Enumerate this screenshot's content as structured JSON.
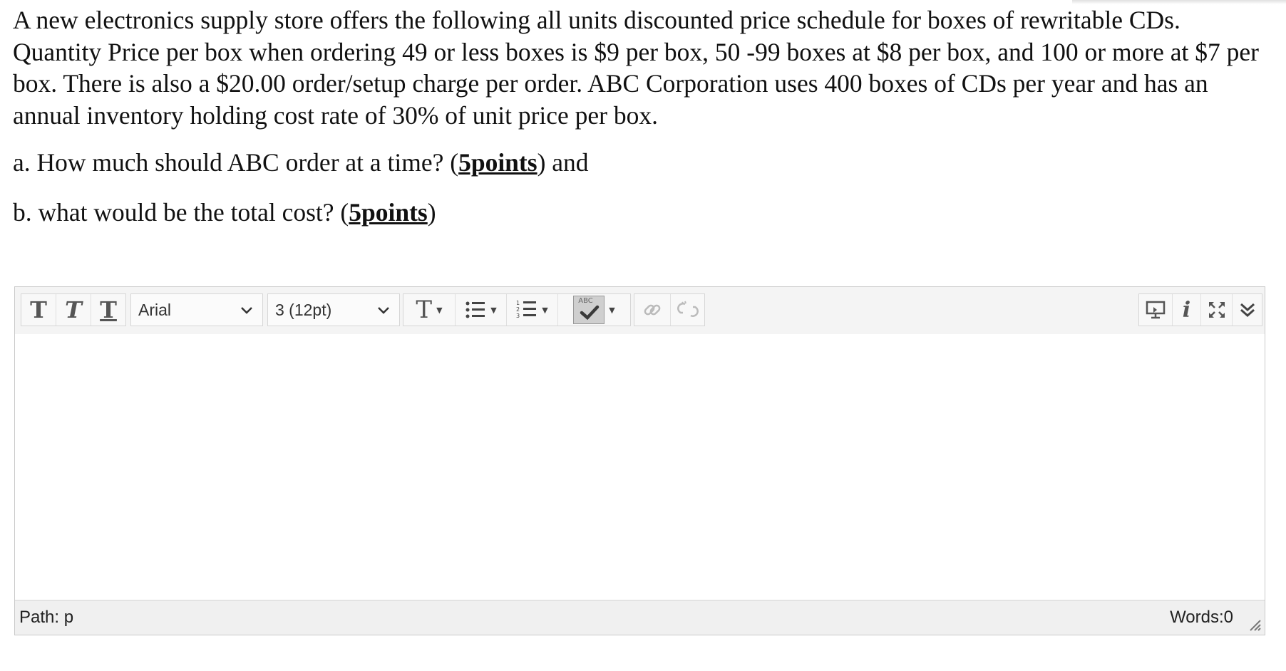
{
  "question": {
    "paragraph": "A new electronics supply store offers the following all units discounted price schedule for boxes of rewritable CDs. Quantity Price per box when ordering 49 or less boxes is $9 per box, 50 -99 boxes at $8 per box, and 100 or more at $7 per box. There is also a $20.00 order/setup charge per order. ABC Corporation uses 400 boxes of CDs per year and has an annual inventory holding cost rate of 30% of unit price per box.",
    "part_a": {
      "text": "a. How much should ABC order at a time? (",
      "points": "5points",
      "suffix": ") and"
    },
    "part_b": {
      "text": "b. what would be the total cost? (",
      "points": "5points",
      "suffix": ")"
    }
  },
  "editor": {
    "toolbar": {
      "bold_label": "T",
      "italic_label": "T",
      "underline_label": "T",
      "font_family": "Arial",
      "font_size": "3 (12pt)",
      "text_color_label": "T",
      "spellcheck_label": "ABC"
    },
    "status": {
      "path": "Path: p",
      "words": "Words:0"
    }
  },
  "icons": {
    "bold": "bold-icon",
    "italic": "italic-icon",
    "underline": "underline-icon",
    "text-color": "text-color-icon",
    "bullet-list": "bullet-list-icon",
    "numbered-list": "numbered-list-icon",
    "spellcheck": "spellcheck-icon",
    "link": "link-icon",
    "unlink": "unlink-icon",
    "preview": "preview-icon",
    "info": "info-icon",
    "fullscreen": "fullscreen-icon",
    "collapse": "collapse-icon"
  }
}
